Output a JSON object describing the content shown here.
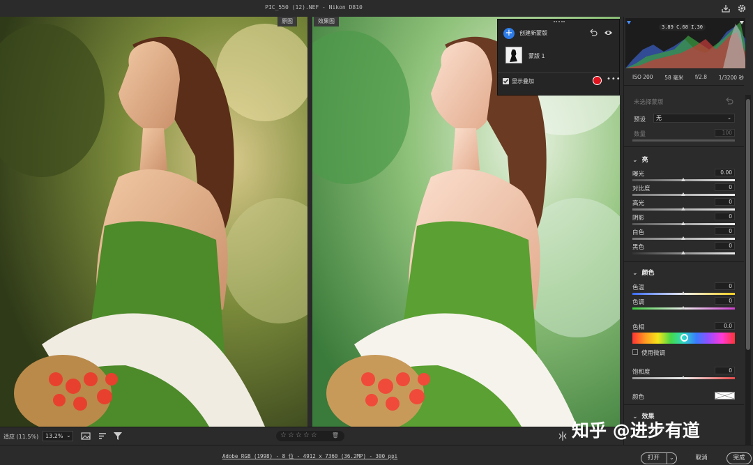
{
  "titlebar": {
    "title": "PIC_550 (12).NEF - Nikon D810"
  },
  "compare": {
    "before_label": "原图",
    "after_label": "效果图"
  },
  "mask_panel": {
    "create_label": "创建新蒙版",
    "mask_name": "蒙版 1",
    "show_overlay_label": "显示叠加",
    "overlay_color": "#e0141e"
  },
  "histogram": {
    "readout": "3.89  C.68  I.30"
  },
  "exif": {
    "iso": "ISO 200",
    "focal": "58 毫米",
    "aperture": "f/2.8",
    "shutter": "1/3200 秒"
  },
  "mask_controls": {
    "no_mask": "未选择蒙版",
    "preset_label": "预设",
    "preset_value": "无",
    "amount_label": "数量",
    "amount_value": "100"
  },
  "light": {
    "title": "亮",
    "rows": [
      {
        "label": "曝光",
        "value": "0.00"
      },
      {
        "label": "对比度",
        "value": "0"
      },
      {
        "label": "高光",
        "value": "0"
      },
      {
        "label": "阴影",
        "value": "0"
      },
      {
        "label": "白色",
        "value": "0"
      },
      {
        "label": "黑色",
        "value": "0"
      }
    ]
  },
  "color": {
    "title": "颜色",
    "temp_label": "色温",
    "temp_value": "0",
    "tint_label": "色调",
    "tint_value": "0",
    "hue_label": "色相",
    "hue_value": "0.0",
    "fine_label": "使用微调",
    "sat_label": "饱和度",
    "sat_value": "0",
    "color_label": "颜色"
  },
  "effects": {
    "title": "效果"
  },
  "filmstrip": {
    "fit_label": "适应 (11.5%)",
    "zoom_value": "13.2%",
    "stars": "☆☆☆☆☆"
  },
  "watermark": "知乎 @进步有道",
  "bottom": {
    "info": "Adobe RGB (1998) - 8 位 - 4912 x 7360 (36.2MP) - 300 ppi",
    "open_label": "打开",
    "cancel_label": "取消",
    "done_label": "完成"
  }
}
